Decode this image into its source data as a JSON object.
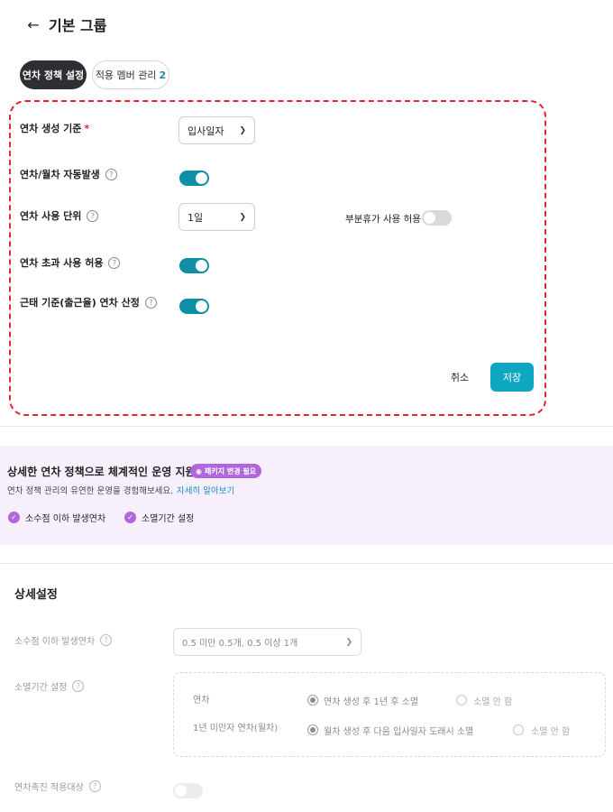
{
  "header": {
    "title": "기본 그룹",
    "back_icon": "arrow-left-icon"
  },
  "tabs": [
    {
      "label": "연차 정책 설정",
      "active": true
    },
    {
      "label": "적용 멤버 관리",
      "count": "2",
      "active": false
    }
  ],
  "policy": {
    "basis_label": "연차 생성 기준",
    "basis_required": "*",
    "basis_value": "입사일자",
    "auto_label": "연차/월차 자동발생",
    "unit_label": "연차 사용 단위",
    "unit_value": "1일",
    "partial_label": "부분휴가 사용 허용",
    "overuse_label": "연차 초과 사용 허용",
    "attendance_label": "근태 기준(출근율) 연차 산정",
    "help_glyph": "?",
    "toggles": {
      "auto": true,
      "partial": false,
      "overuse": true,
      "attendance": true
    }
  },
  "actions": {
    "cancel": "취소",
    "save": "저장"
  },
  "promo": {
    "title": "상세한 연차 정책으로 체계적인 운영 지원",
    "badge": "패키지 변경 필요",
    "subtitle": "연차 정책 관리의 유연한 운영을 경험해보세요.",
    "link": "자세히 알아보기",
    "features": [
      "소수점 이하 발생연차",
      "소멸기간 설정"
    ],
    "accent_color": "#b266dd"
  },
  "detail": {
    "title": "상세설정",
    "decimal_label": "소수점 이하 발생연차",
    "decimal_value": "0.5 미만 0.5개, 0.5 이상 1개",
    "expiry_label": "소멸기간 설정",
    "annual_label": "연차",
    "annual_opt1": "연차 생성 후 1년 후 소멸",
    "annual_opt2": "소멸 안 함",
    "monthly_label": "1년 미만자 연차(월차)",
    "monthly_opt1": "월차 생성 후 다음 입사일자 도래시 소멸",
    "monthly_opt2": "소멸 안 함",
    "promotion_label": "연차촉진 적용대상",
    "promotion_on": false
  },
  "colors": {
    "toggle_on": "#0e8fa3",
    "save_button": "#0ea7c2",
    "dashed_border": "#e0262e"
  }
}
